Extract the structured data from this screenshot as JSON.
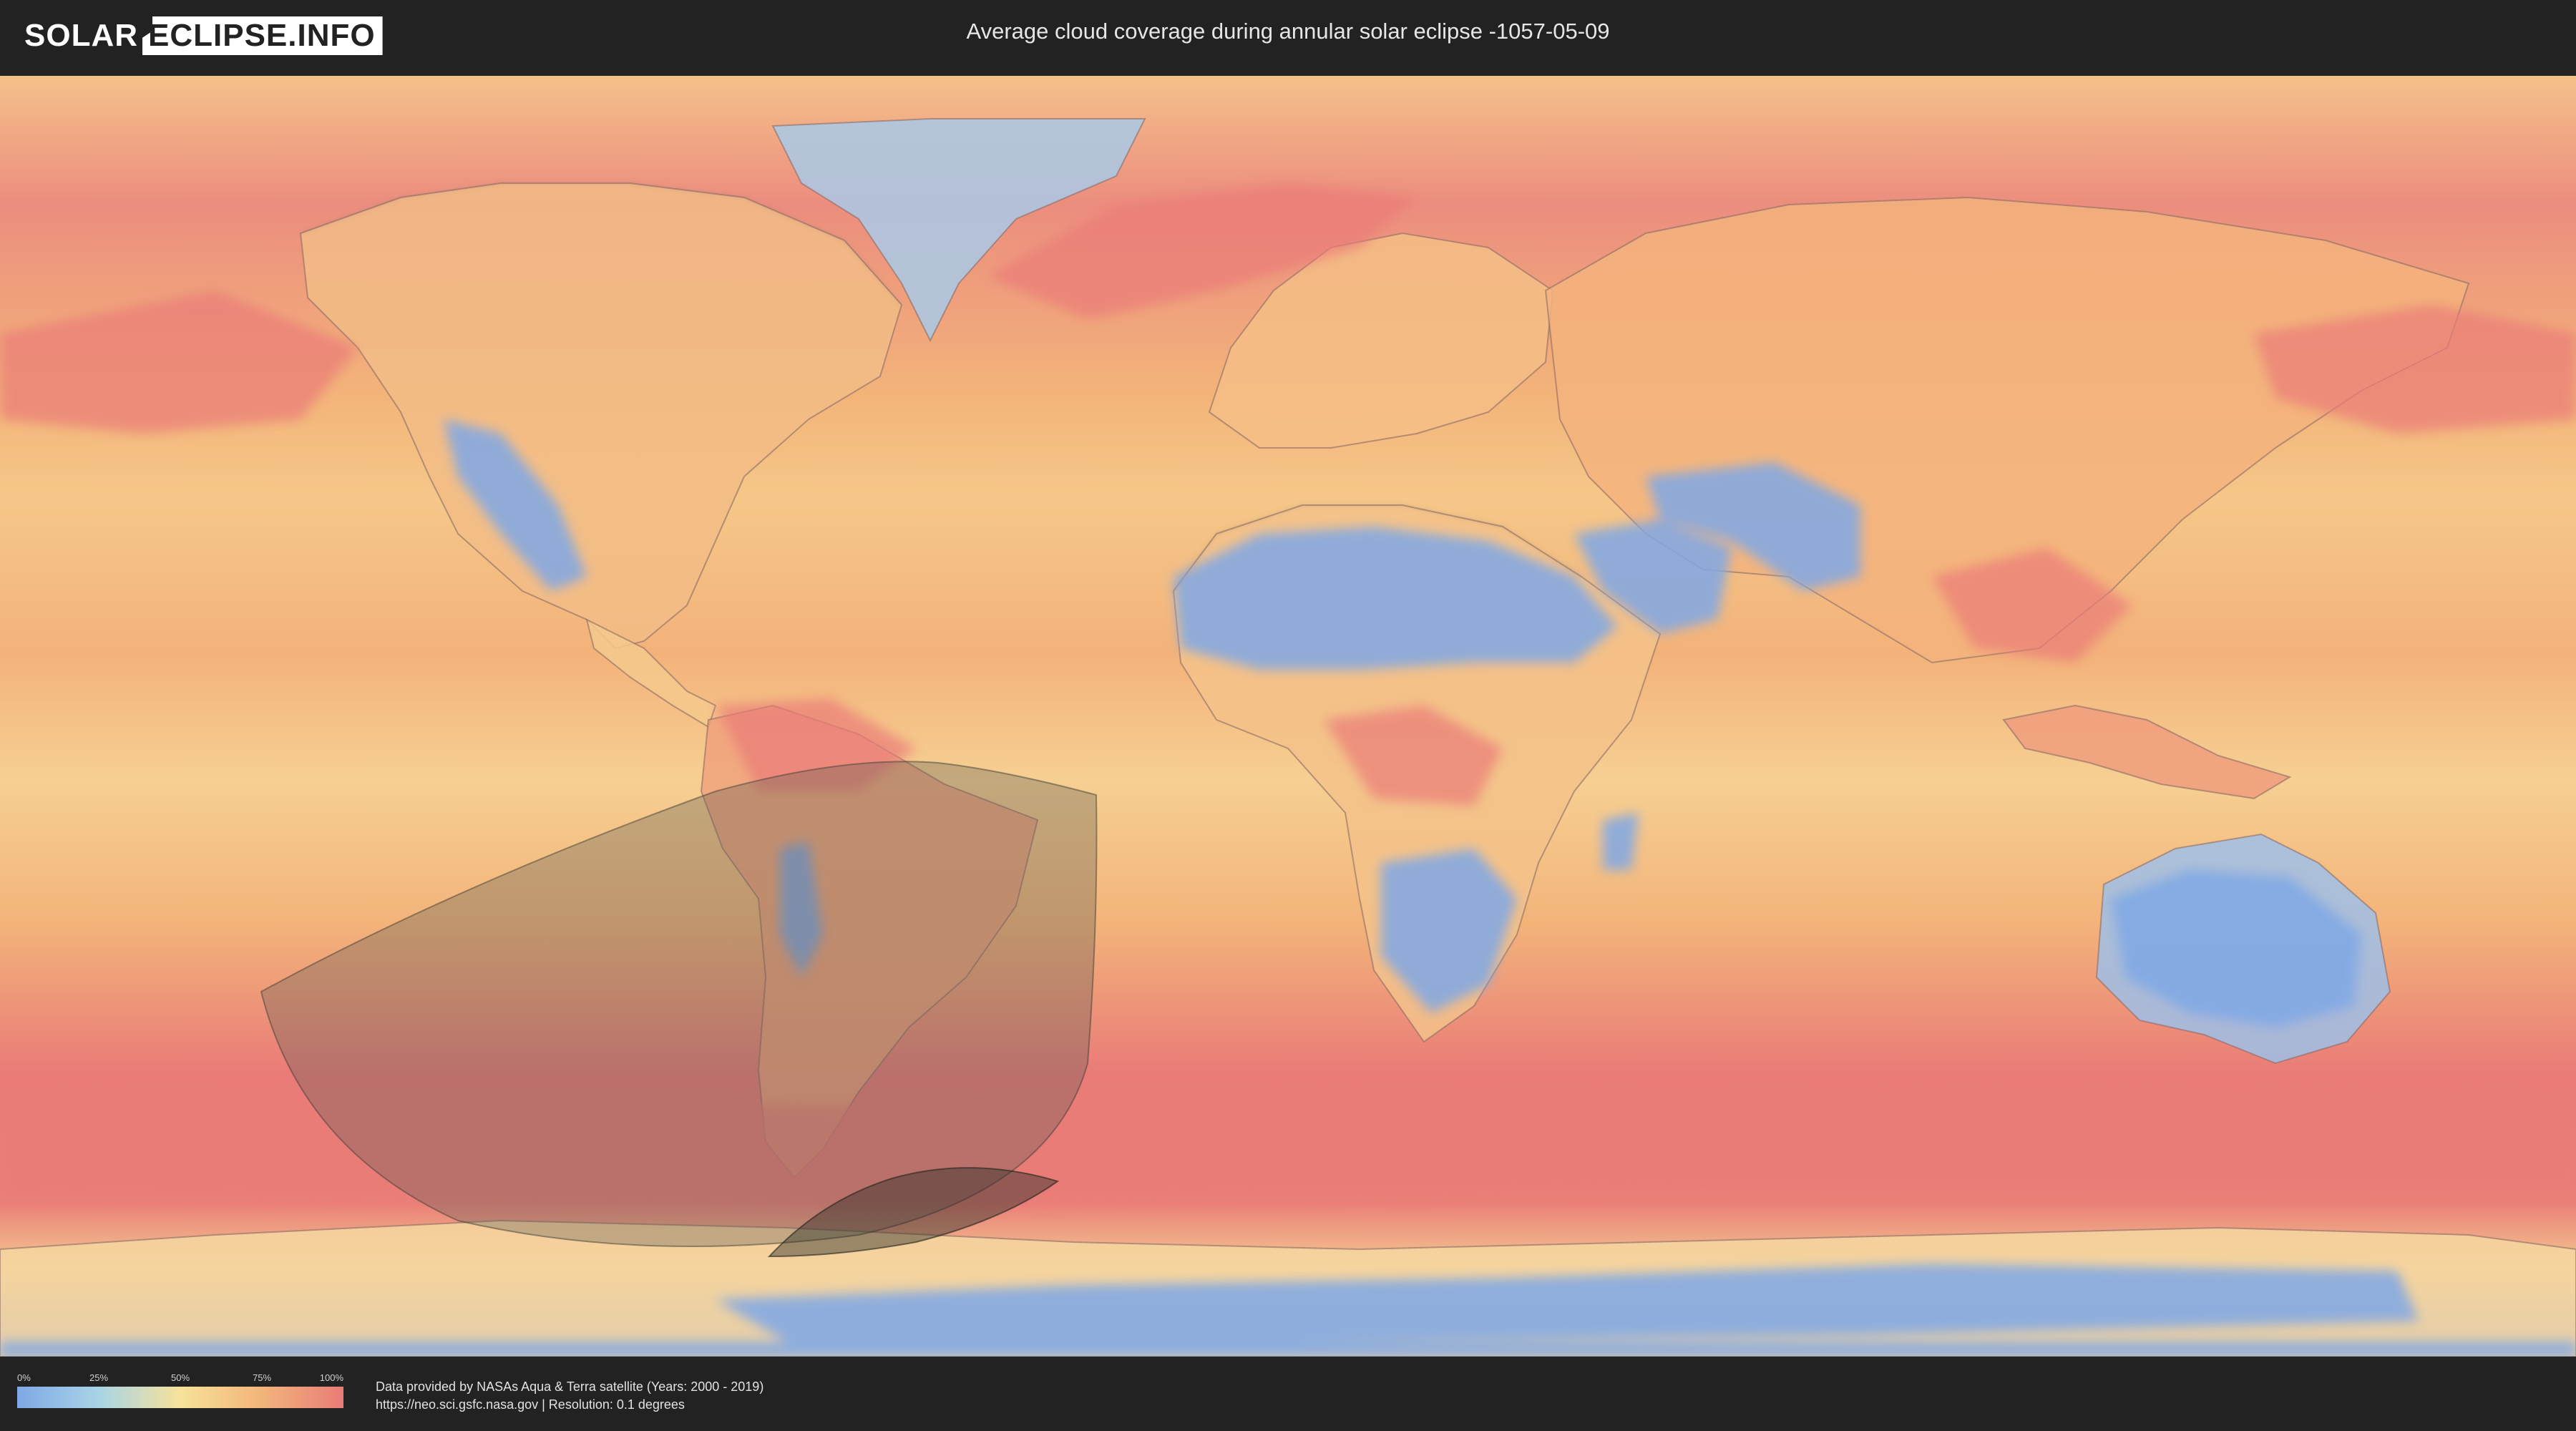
{
  "header": {
    "logo_left": "SOLAR",
    "logo_right": "ECLIPSE.INFO",
    "title": "Average cloud coverage during annular solar eclipse -1057-05-09"
  },
  "legend": {
    "ticks": [
      "0%",
      "25%",
      "50%",
      "75%",
      "100%"
    ],
    "colors": [
      "#7fa8e6",
      "#a8d4e6",
      "#f7e29a",
      "#f3b47a",
      "#ea7b78"
    ]
  },
  "footer": {
    "credit_line_1": "Data provided by NASAs Aqua & Terra satellite (Years: 2000 - 2019)",
    "credit_line_2": "https://neo.sci.gsfc.nasa.gov | Resolution: 0.1 degrees"
  },
  "map": {
    "projection": "equirectangular",
    "colors": {
      "cloudy": "#ea7b78",
      "partly": "#f3b47a",
      "mixed": "#f7e29a",
      "clear": "#7fa8e6",
      "eclipse_zone": "#5a5a52",
      "annular_path": "#2e2e28"
    }
  }
}
